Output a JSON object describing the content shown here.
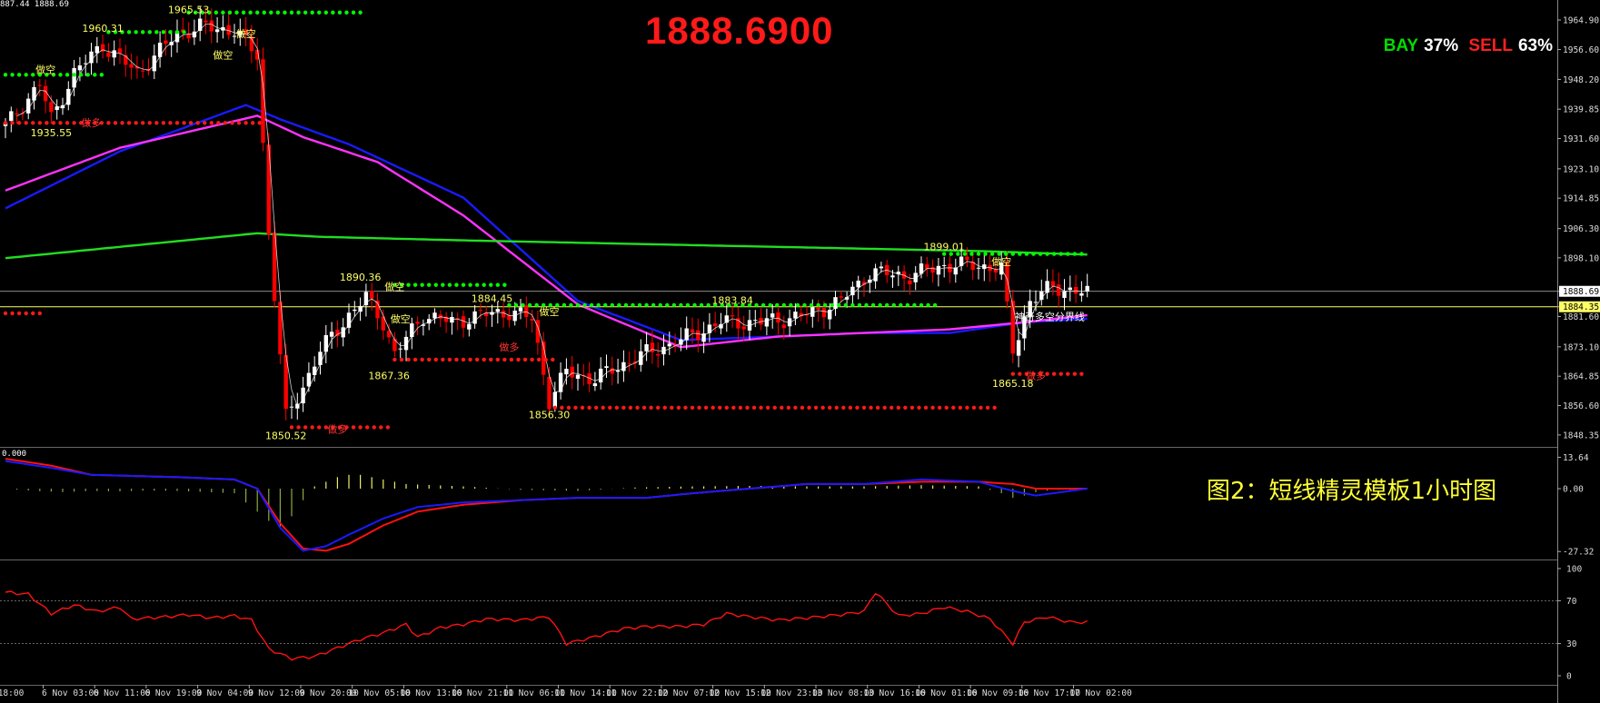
{
  "header": {
    "ohlc_fragment": "887.44 1888.69"
  },
  "price_display": "1888.6900",
  "bay_sell": {
    "bay_label": "BAY",
    "bay_value": "37%",
    "sell_label": "SELL",
    "sell_value": "63%"
  },
  "subtitle": "图2：短线精灵模板1小时图",
  "colors": {
    "bull": "#ffffff",
    "bear": "#ff0000",
    "up_dots": "#00ff00",
    "dn_dots": "#ff1a1a",
    "ma_blue": "#1a1aff",
    "ma_magenta": "#ff33ff",
    "ma_green": "#22dd22",
    "hline": "#ffff66",
    "sub_red": "#ff1111"
  },
  "chart_data": [
    {
      "type": "candlestick",
      "title": "",
      "y_ticks": [
        "1964.90",
        "1956.60",
        "1948.20",
        "1939.85",
        "1931.60",
        "1923.10",
        "1914.85",
        "1906.30",
        "1898.10",
        "1888.69",
        "1884.35",
        "1881.60",
        "1873.10",
        "1864.85",
        "1856.60",
        "1848.35"
      ],
      "ylim": [
        1845,
        1970
      ],
      "current_price": 1888.69,
      "boundary_price": 1884.35,
      "boundary_label": "神奇多空分界线",
      "x_ticks": [
        "6 Nov 03:00",
        "6 Nov 11:00",
        "6 Nov 19:00",
        "9 Nov 04:00",
        "9 Nov 12:00",
        "9 Nov 20:00",
        "10 Nov 05:00",
        "10 Nov 13:00",
        "10 Nov 21:00",
        "11 Nov 06:00",
        "11 Nov 14:00",
        "11 Nov 22:00",
        "12 Nov 07:00",
        "12 Nov 15:00",
        "12 Nov 23:00",
        "13 Nov 08:00",
        "13 Nov 16:00",
        "16 Nov 01:00",
        "16 Nov 09:00",
        "16 Nov 17:00",
        "17 Nov 02:00"
      ],
      "x_first_label": "18:00",
      "price_labels": [
        {
          "text": "1960.31",
          "bar": 17,
          "price": 1960.31,
          "pos": "above"
        },
        {
          "text": "1965.53",
          "bar": 32,
          "price": 1965.53,
          "pos": "above"
        },
        {
          "text": "1935.55",
          "bar": 8,
          "price": 1935.55,
          "pos": "below"
        },
        {
          "text": "1850.52",
          "bar": 49,
          "price": 1850.52,
          "pos": "below"
        },
        {
          "text": "1890.36",
          "bar": 62,
          "price": 1890.36,
          "pos": "above"
        },
        {
          "text": "1867.36",
          "bar": 67,
          "price": 1867.36,
          "pos": "below"
        },
        {
          "text": "1884.45",
          "bar": 85,
          "price": 1884.45,
          "pos": "above"
        },
        {
          "text": "1856.30",
          "bar": 95,
          "price": 1856.3,
          "pos": "below"
        },
        {
          "text": "1883.84",
          "bar": 127,
          "price": 1883.84,
          "pos": "above"
        },
        {
          "text": "1899.01",
          "bar": 164,
          "price": 1899.01,
          "pos": "above"
        },
        {
          "text": "1865.18",
          "bar": 176,
          "price": 1865.18,
          "pos": "below"
        }
      ],
      "marker_labels": [
        {
          "text": "做空",
          "bar": 7,
          "price": 1950
        },
        {
          "text": "做空",
          "bar": 42,
          "price": 1960
        },
        {
          "text": "做空",
          "bar": 38,
          "price": 1954
        },
        {
          "text": "做多",
          "bar": 15,
          "price": 1935
        },
        {
          "text": "做多",
          "bar": 58,
          "price": 1849
        },
        {
          "text": "做空",
          "bar": 68,
          "price": 1889
        },
        {
          "text": "做空",
          "bar": 69,
          "price": 1880
        },
        {
          "text": "做多",
          "bar": 88,
          "price": 1872
        },
        {
          "text": "做空",
          "bar": 95,
          "price": 1882
        },
        {
          "text": "做空",
          "bar": 174,
          "price": 1896
        },
        {
          "text": "做多",
          "bar": 180,
          "price": 1864
        }
      ],
      "dot_lines": [
        {
          "color": "up",
          "price": 1949.5,
          "from": 0,
          "to": 17
        },
        {
          "color": "up",
          "price": 1961.5,
          "from": 18,
          "to": 32
        },
        {
          "color": "up",
          "price": 1967.0,
          "from": 32,
          "to": 63
        },
        {
          "color": "dn",
          "price": 1936.0,
          "from": 0,
          "to": 45
        },
        {
          "color": "dn",
          "price": 1882.5,
          "from": 0,
          "to": 7
        },
        {
          "color": "dn",
          "price": 1850.5,
          "from": 50,
          "to": 68
        },
        {
          "color": "up",
          "price": 1890.5,
          "from": 68,
          "to": 88
        },
        {
          "color": "dn",
          "price": 1869.5,
          "from": 68,
          "to": 96
        },
        {
          "color": "up",
          "price": 1884.8,
          "from": 88,
          "to": 163
        },
        {
          "color": "dn",
          "price": 1856.0,
          "from": 96,
          "to": 173
        },
        {
          "color": "up",
          "price": 1899.2,
          "from": 164,
          "to": 189
        },
        {
          "color": "dn",
          "price": 1865.5,
          "from": 176,
          "to": 189
        }
      ],
      "anchors": [
        [
          0,
          1935
        ],
        [
          6,
          1947
        ],
        [
          8,
          1937
        ],
        [
          12,
          1950
        ],
        [
          17,
          1958
        ],
        [
          23,
          1950
        ],
        [
          30,
          1961
        ],
        [
          34,
          1963
        ],
        [
          40,
          1962
        ],
        [
          44,
          1955
        ],
        [
          46,
          1905
        ],
        [
          49,
          1853
        ],
        [
          52,
          1862
        ],
        [
          55,
          1872
        ],
        [
          60,
          1882
        ],
        [
          63,
          1887
        ],
        [
          66,
          1880
        ],
        [
          68,
          1871
        ],
        [
          73,
          1882
        ],
        [
          78,
          1880
        ],
        [
          83,
          1882
        ],
        [
          88,
          1883
        ],
        [
          92,
          1881
        ],
        [
          95,
          1858
        ],
        [
          98,
          1866
        ],
        [
          103,
          1864
        ],
        [
          110,
          1870
        ],
        [
          118,
          1875
        ],
        [
          125,
          1880
        ],
        [
          132,
          1880
        ],
        [
          140,
          1882
        ],
        [
          146,
          1886
        ],
        [
          151,
          1894
        ],
        [
          158,
          1893
        ],
        [
          164,
          1896
        ],
        [
          170,
          1896
        ],
        [
          174,
          1895
        ],
        [
          176,
          1872
        ],
        [
          179,
          1886
        ],
        [
          183,
          1890
        ],
        [
          186,
          1889
        ],
        [
          189,
          1888
        ]
      ],
      "moving_averages": [
        {
          "name": "blue",
          "color": "ma_blue",
          "points": [
            [
              0,
              1912
            ],
            [
              20,
              1928
            ],
            [
              42,
              1941
            ],
            [
              48,
              1937
            ],
            [
              60,
              1930
            ],
            [
              80,
              1915
            ],
            [
              100,
              1886
            ],
            [
              118,
              1875
            ],
            [
              135,
              1876
            ],
            [
              150,
              1877
            ],
            [
              165,
              1877
            ],
            [
              178,
              1880
            ],
            [
              189,
              1881
            ]
          ]
        },
        {
          "name": "magenta",
          "color": "ma_magenta",
          "points": [
            [
              0,
              1917
            ],
            [
              20,
              1929
            ],
            [
              44,
              1938
            ],
            [
              52,
              1932
            ],
            [
              65,
              1925
            ],
            [
              80,
              1910
            ],
            [
              100,
              1885
            ],
            [
              118,
              1873
            ],
            [
              135,
              1876
            ],
            [
              150,
              1877
            ],
            [
              165,
              1878
            ],
            [
              178,
              1880
            ],
            [
              189,
              1882
            ]
          ]
        },
        {
          "name": "green",
          "color": "ma_green",
          "points": [
            [
              0,
              1898
            ],
            [
              44,
              1905
            ],
            [
              55,
              1904
            ],
            [
              80,
              1903
            ],
            [
              110,
              1902
            ],
            [
              140,
              1901
            ],
            [
              170,
              1900
            ],
            [
              189,
              1899
            ]
          ]
        }
      ],
      "hlines": [
        1888.69,
        1884.35
      ]
    },
    {
      "type": "line",
      "title": "",
      "y_ticks": [
        "13.64",
        "0.00",
        "-27.32"
      ],
      "ylim": [
        -30,
        15
      ],
      "zero_label": "0.000",
      "series": [
        {
          "color": "sub_red",
          "points": [
            [
              0,
              13
            ],
            [
              8,
              10
            ],
            [
              15,
              6
            ],
            [
              30,
              5
            ],
            [
              40,
              4
            ],
            [
              44,
              0
            ],
            [
              48,
              -15
            ],
            [
              52,
              -26
            ],
            [
              56,
              -27
            ],
            [
              60,
              -24
            ],
            [
              66,
              -16
            ],
            [
              72,
              -10
            ],
            [
              80,
              -7
            ],
            [
              90,
              -5
            ],
            [
              100,
              -4
            ],
            [
              106,
              -4
            ],
            [
              112,
              -4
            ],
            [
              120,
              -2
            ],
            [
              130,
              0
            ],
            [
              140,
              2
            ],
            [
              150,
              2
            ],
            [
              160,
              3
            ],
            [
              170,
              3
            ],
            [
              176,
              2
            ],
            [
              180,
              0
            ],
            [
              189,
              0
            ]
          ]
        },
        {
          "color": "ma_blue",
          "points": [
            [
              0,
              12
            ],
            [
              8,
              9
            ],
            [
              15,
              6
            ],
            [
              30,
              5
            ],
            [
              40,
              4
            ],
            [
              44,
              0
            ],
            [
              48,
              -17
            ],
            [
              52,
              -27
            ],
            [
              56,
              -25
            ],
            [
              60,
              -20
            ],
            [
              66,
              -13
            ],
            [
              72,
              -8
            ],
            [
              80,
              -6
            ],
            [
              90,
              -5
            ],
            [
              100,
              -4
            ],
            [
              106,
              -4
            ],
            [
              112,
              -4
            ],
            [
              120,
              -2
            ],
            [
              130,
              0
            ],
            [
              140,
              2
            ],
            [
              150,
              2
            ],
            [
              160,
              4
            ],
            [
              170,
              3
            ],
            [
              176,
              -1
            ],
            [
              180,
              -3
            ],
            [
              189,
              0
            ]
          ]
        }
      ],
      "histogram": [
        [
          0,
          0
        ],
        [
          5,
          -1
        ],
        [
          10,
          -1.5
        ],
        [
          15,
          -1
        ],
        [
          20,
          -1.2
        ],
        [
          25,
          -0.8
        ],
        [
          30,
          -1
        ],
        [
          35,
          -1.5
        ],
        [
          40,
          -2
        ],
        [
          43,
          -8
        ],
        [
          46,
          -14
        ],
        [
          48,
          -17
        ],
        [
          50,
          -12
        ],
        [
          52,
          -5
        ],
        [
          54,
          1
        ],
        [
          56,
          3
        ],
        [
          58,
          5
        ],
        [
          60,
          6
        ],
        [
          62,
          6
        ],
        [
          64,
          5
        ],
        [
          66,
          4
        ],
        [
          68,
          3
        ],
        [
          70,
          2
        ],
        [
          75,
          1.5
        ],
        [
          80,
          1
        ],
        [
          90,
          -0.5
        ],
        [
          100,
          -1
        ],
        [
          110,
          0.5
        ],
        [
          120,
          1
        ],
        [
          130,
          1.2
        ],
        [
          140,
          1
        ],
        [
          150,
          1
        ],
        [
          160,
          1.5
        ],
        [
          170,
          1
        ],
        [
          174,
          -2
        ],
        [
          176,
          -4
        ],
        [
          178,
          -3
        ],
        [
          180,
          -1.5
        ],
        [
          183,
          -0.5
        ]
      ]
    },
    {
      "type": "line",
      "title": "",
      "y_ticks": [
        "100",
        "70",
        "30",
        "0"
      ],
      "ylim": [
        0,
        100
      ],
      "series": [
        {
          "color": "sub_red",
          "points": [
            [
              0,
              78
            ],
            [
              4,
              76
            ],
            [
              8,
              58
            ],
            [
              12,
              66
            ],
            [
              16,
              60
            ],
            [
              20,
              64
            ],
            [
              22,
              53
            ],
            [
              28,
              55
            ],
            [
              32,
              57
            ],
            [
              36,
              54
            ],
            [
              40,
              56
            ],
            [
              43,
              52
            ],
            [
              46,
              25
            ],
            [
              50,
              16
            ],
            [
              54,
              18
            ],
            [
              58,
              26
            ],
            [
              62,
              34
            ],
            [
              66,
              40
            ],
            [
              70,
              48
            ],
            [
              72,
              36
            ],
            [
              76,
              45
            ],
            [
              80,
              48
            ],
            [
              84,
              53
            ],
            [
              90,
              52
            ],
            [
              95,
              55
            ],
            [
              98,
              30
            ],
            [
              102,
              35
            ],
            [
              108,
              44
            ],
            [
              112,
              46
            ],
            [
              118,
              46
            ],
            [
              122,
              48
            ],
            [
              126,
              58
            ],
            [
              130,
              55
            ],
            [
              135,
              52
            ],
            [
              140,
              54
            ],
            [
              146,
              57
            ],
            [
              150,
              60
            ],
            [
              152,
              78
            ],
            [
              156,
              56
            ],
            [
              160,
              58
            ],
            [
              164,
              64
            ],
            [
              168,
              60
            ],
            [
              172,
              53
            ],
            [
              176,
              30
            ],
            [
              178,
              50
            ],
            [
              182,
              55
            ],
            [
              186,
              50
            ],
            [
              189,
              50
            ]
          ]
        }
      ]
    }
  ]
}
